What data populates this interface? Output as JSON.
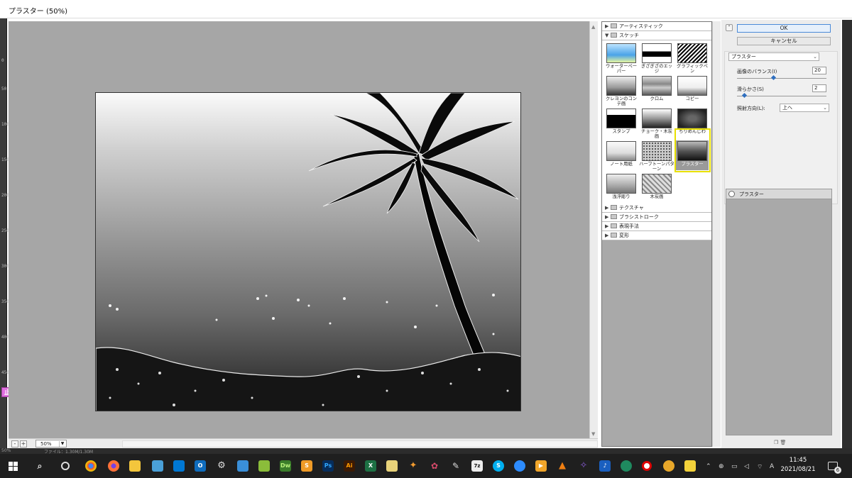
{
  "window": {
    "title": "プラスター (50%)"
  },
  "ruler": {
    "marks": [
      "0",
      "50",
      "100",
      "150",
      "200",
      "250",
      "300",
      "350",
      "400",
      "450"
    ]
  },
  "stop_badge": "止",
  "preview": {
    "zoom": "50%",
    "zoom_out": "-",
    "zoom_in": "+"
  },
  "gallery": {
    "folders_top": [
      {
        "label": "アーティスティック",
        "expanded": false
      }
    ],
    "sketch_folder": {
      "label": "スケッチ",
      "expanded": true
    },
    "thumbs": [
      {
        "label": "ウォーターペーパー",
        "selected": false
      },
      {
        "label": "ぎざぎざのエッジ",
        "selected": false
      },
      {
        "label": "グラフィックペン",
        "selected": false
      },
      {
        "label": "クレヨンのコンテ画",
        "selected": false
      },
      {
        "label": "クロム",
        "selected": false
      },
      {
        "label": "コピー",
        "selected": false
      },
      {
        "label": "スタンプ",
        "selected": false
      },
      {
        "label": "チョーク・木炭画",
        "selected": false
      },
      {
        "label": "ちりめんじわ",
        "selected": false
      },
      {
        "label": "ノート用紙",
        "selected": false
      },
      {
        "label": "ハーフトーンパターン",
        "selected": false
      },
      {
        "label": "プラスター",
        "selected": true
      },
      {
        "label": "浅浮彫り",
        "selected": false
      },
      {
        "label": "木炭画",
        "selected": false
      }
    ],
    "folders_bottom": [
      {
        "label": "テクスチャ"
      },
      {
        "label": "ブラシストローク"
      },
      {
        "label": "表現手法"
      },
      {
        "label": "変形"
      }
    ]
  },
  "settings": {
    "ok_label": "OK",
    "cancel_label": "キャンセル",
    "filter_select": "プラスター",
    "balance_label": "画像のバランス(I)",
    "balance_value": "20",
    "smooth_label": "滑らかさ(S)",
    "smooth_value": "2",
    "direction_label": "照射方向(L):",
    "direction_value": "上へ",
    "layer_name": "プラスター"
  },
  "statusbar": {
    "zoom": "50%",
    "info": "ファイル：1.30M/1.30M"
  },
  "taskbar": {
    "apps": [
      "search",
      "cortana",
      "chrome",
      "firefox",
      "explorer",
      "edge-legacy",
      "photos",
      "outlook",
      "settings",
      "news",
      "maps",
      "Dw",
      "sublime",
      "Ps",
      "Ai",
      "X",
      "notepad",
      "butterfly",
      "paint",
      "pen",
      "7z",
      "S",
      "zoom",
      "media",
      "vlc",
      "mail",
      "music",
      "app-globe",
      "rec",
      "face",
      "sticky"
    ],
    "time": "11:45",
    "date": "2021/08/21",
    "notifications": "6",
    "ime": "A"
  }
}
